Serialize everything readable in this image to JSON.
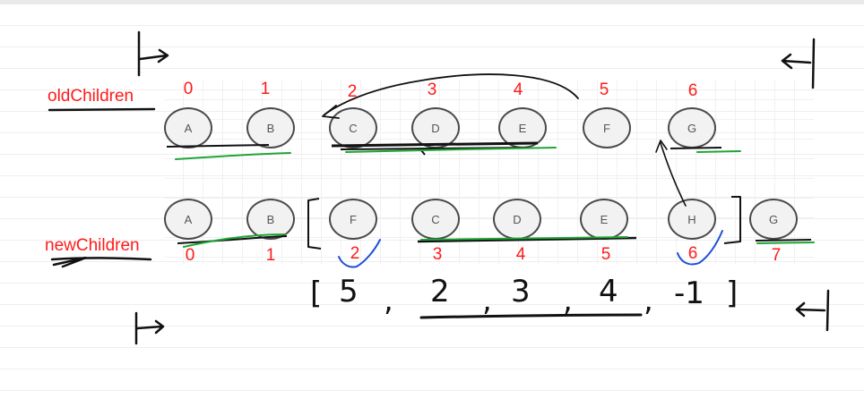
{
  "labels": {
    "old_children": "oldChildren",
    "new_children": "newChildren"
  },
  "old_nodes": [
    {
      "label": "A",
      "index": "0"
    },
    {
      "label": "B",
      "index": "1"
    },
    {
      "label": "C",
      "index": "2"
    },
    {
      "label": "D",
      "index": "3"
    },
    {
      "label": "E",
      "index": "4"
    },
    {
      "label": "F",
      "index": "5"
    },
    {
      "label": "G",
      "index": "6"
    }
  ],
  "new_nodes": [
    {
      "label": "A",
      "index": "0"
    },
    {
      "label": "B",
      "index": "1"
    },
    {
      "label": "F",
      "index": "2"
    },
    {
      "label": "C",
      "index": "3"
    },
    {
      "label": "D",
      "index": "4"
    },
    {
      "label": "E",
      "index": "5"
    },
    {
      "label": "H",
      "index": "6"
    },
    {
      "label": "G",
      "index": "7"
    }
  ],
  "handwritten_array": {
    "open": "[",
    "values": [
      "5",
      "2",
      "3",
      "4",
      "-1"
    ],
    "separator": ",",
    "close": "]"
  },
  "colors": {
    "index_red": "#ff1a1a",
    "ink": "#111111",
    "green_highlight": "#1fa535",
    "blue_check": "#1f4fd6"
  }
}
